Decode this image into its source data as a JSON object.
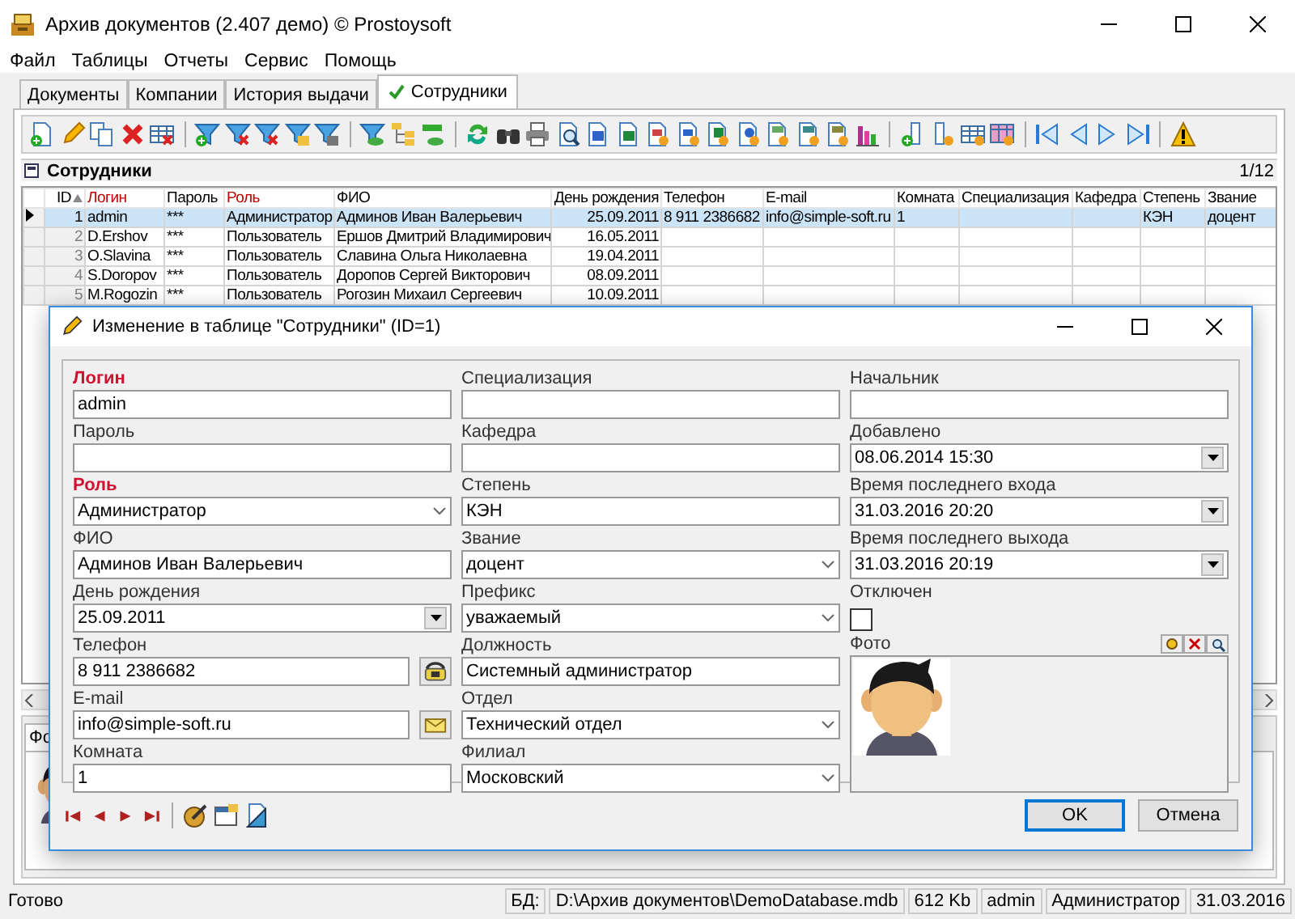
{
  "window": {
    "title": "Архив документов (2.407 демо) © Prostoysoft"
  },
  "menu": [
    {
      "label": "Файл"
    },
    {
      "label": "Таблицы"
    },
    {
      "label": "Отчеты"
    },
    {
      "label": "Сервис"
    },
    {
      "label": "Помощь"
    }
  ],
  "tabs": [
    {
      "label": "Документы",
      "selected": false
    },
    {
      "label": "Компании",
      "selected": false
    },
    {
      "label": "История выдачи",
      "selected": false
    },
    {
      "label": "Сотрудники",
      "selected": true
    }
  ],
  "grid": {
    "title": "Сотрудники",
    "counter": "1/12",
    "columns": [
      {
        "label": "ID",
        "required": false,
        "sorted": true,
        "kind": "number"
      },
      {
        "label": "Логин",
        "required": true,
        "sorted": false,
        "kind": "text"
      },
      {
        "label": "Пароль",
        "required": false,
        "sorted": false,
        "kind": "text"
      },
      {
        "label": "Роль",
        "required": true,
        "sorted": false,
        "kind": "text"
      },
      {
        "label": "ФИО",
        "required": false,
        "sorted": false,
        "kind": "text"
      },
      {
        "label": "День рождения",
        "required": false,
        "sorted": false,
        "kind": "date"
      },
      {
        "label": "Телефон",
        "required": false,
        "sorted": false,
        "kind": "text"
      },
      {
        "label": "E-mail",
        "required": false,
        "sorted": false,
        "kind": "text"
      },
      {
        "label": "Комната",
        "required": false,
        "sorted": false,
        "kind": "text"
      },
      {
        "label": "Специализация",
        "required": false,
        "sorted": false,
        "kind": "text"
      },
      {
        "label": "Кафедра",
        "required": false,
        "sorted": false,
        "kind": "text"
      },
      {
        "label": "Степень",
        "required": false,
        "sorted": false,
        "kind": "text"
      },
      {
        "label": "Звание",
        "required": false,
        "sorted": false,
        "kind": "text"
      }
    ],
    "rows": [
      {
        "selected": true,
        "cells": [
          "1",
          "admin",
          "***",
          "Администратор",
          "Админов Иван Валерьевич",
          "25.09.2011",
          "8 911 2386682",
          "info@simple-soft.ru",
          "1",
          null,
          null,
          "КЭН",
          "доцент"
        ]
      },
      {
        "selected": false,
        "cells": [
          "2",
          "D.Ershov",
          "***",
          "Пользователь",
          "Ершов Дмитрий Владимирович",
          "16.05.2011",
          null,
          null,
          null,
          null,
          null,
          null,
          null
        ]
      },
      {
        "selected": false,
        "cells": [
          "3",
          "O.Slavina",
          "***",
          "Пользователь",
          "Славина Ольга Николаевна",
          "19.04.2011",
          null,
          null,
          null,
          null,
          null,
          null,
          null
        ]
      },
      {
        "selected": false,
        "cells": [
          "4",
          "S.Doropov",
          "***",
          "Пользователь",
          "Доропов Сергей Викторович",
          "08.09.2011",
          null,
          null,
          null,
          null,
          null,
          null,
          null
        ]
      },
      {
        "selected": false,
        "cells": [
          "5",
          "M.Rogozin",
          "***",
          "Пользователь",
          "Рогозин Михаил Сергеевич",
          "10.09.2011",
          null,
          null,
          null,
          null,
          null,
          null,
          null
        ]
      }
    ]
  },
  "bottom_panel": {
    "tab": "Фо"
  },
  "dialog": {
    "title": "Изменение в таблице \"Сотрудники\" (ID=1)",
    "columns": [
      [
        {
          "kind": "text",
          "label": "Логин",
          "required": true,
          "value": "admin"
        },
        {
          "kind": "text",
          "label": "Пароль",
          "required": false
        },
        {
          "kind": "combo",
          "label": "Роль",
          "required": true,
          "value": "Администратор"
        },
        {
          "kind": "text",
          "label": "ФИО",
          "required": false,
          "value": "Админов Иван Валерьевич"
        },
        {
          "kind": "date",
          "label": "День рождения",
          "required": false,
          "value": "25.09.2011"
        },
        {
          "kind": "phone",
          "label": "Телефон",
          "required": false,
          "value": "8 911 2386682"
        },
        {
          "kind": "email",
          "label": "E-mail",
          "required": false,
          "value": "info@simple-soft.ru"
        },
        {
          "kind": "text",
          "label": "Комната",
          "required": false,
          "value": "1"
        }
      ],
      [
        {
          "kind": "text",
          "label": "Специализация",
          "required": false
        },
        {
          "kind": "text",
          "label": "Кафедра",
          "required": false
        },
        {
          "kind": "text",
          "label": "Степень",
          "required": false,
          "value": "КЭН"
        },
        {
          "kind": "combo",
          "label": "Звание",
          "required": false,
          "value": "доцент"
        },
        {
          "kind": "combo",
          "label": "Префикс",
          "required": false,
          "value": "уважаемый"
        },
        {
          "kind": "text",
          "label": "Должность",
          "required": false,
          "value": "Системный администратор"
        },
        {
          "kind": "combo",
          "label": "Отдел",
          "required": false,
          "value": "Технический отдел"
        },
        {
          "kind": "combo",
          "label": "Филиал",
          "required": false,
          "value": "Московский"
        }
      ],
      [
        {
          "kind": "text",
          "label": "Начальник",
          "required": false
        },
        {
          "kind": "date",
          "label": "Добавлено",
          "required": false,
          "value": "08.06.2014 15:30"
        },
        {
          "kind": "date",
          "label": "Время последнего входа",
          "required": false,
          "value": "31.03.2016 20:20"
        },
        {
          "kind": "date",
          "label": "Время последнего выхода",
          "required": false,
          "value": "31.03.2016 20:19"
        },
        {
          "kind": "checkbox",
          "label": "Отключен",
          "required": false,
          "checked": false
        },
        {
          "label": "Фото",
          "required": false
        }
      ]
    ],
    "buttons": [
      {
        "label": "OK",
        "default": true
      },
      {
        "label": "Отмена",
        "default": false
      }
    ]
  },
  "status_bar": [
    "Готово",
    "БД:",
    "D:\\Архив документов\\DemoDatabase.mdb",
    "612 Kb",
    "admin",
    "Администратор",
    "31.03.2016"
  ]
}
